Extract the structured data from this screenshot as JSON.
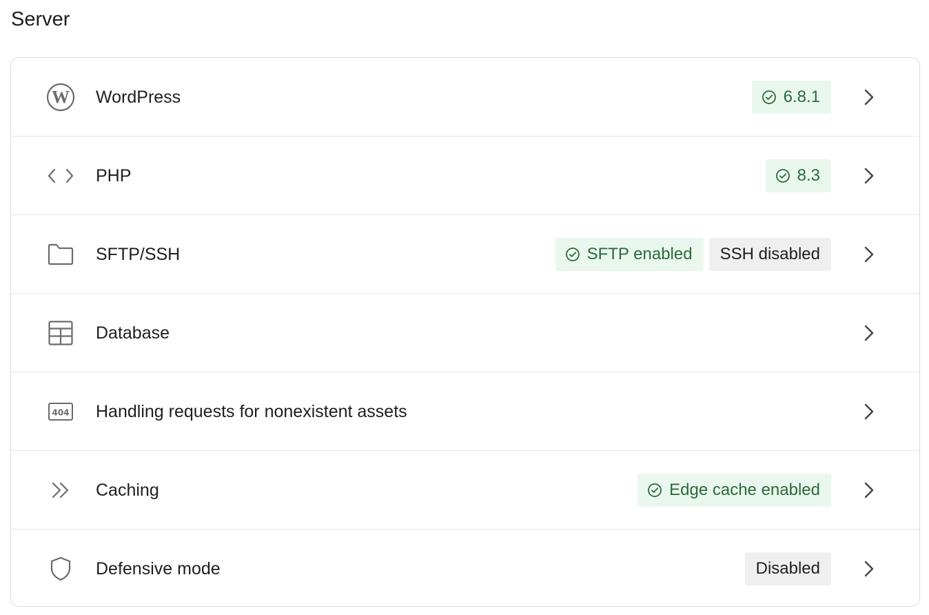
{
  "section": {
    "title": "Server"
  },
  "colors": {
    "success_bg": "#eaf7ee",
    "success_text": "#2b6a3c",
    "neutral_bg": "#efefef",
    "icon": "#6b6b6b",
    "border": "#dcdcde"
  },
  "rows": [
    {
      "label": "WordPress",
      "icon": "wordpress-icon",
      "badges": [
        {
          "text": "6.8.1",
          "status": "success"
        }
      ]
    },
    {
      "label": "PHP",
      "icon": "code-icon",
      "badges": [
        {
          "text": "8.3",
          "status": "success"
        }
      ]
    },
    {
      "label": "SFTP/SSH",
      "icon": "folder-icon",
      "badges": [
        {
          "text": "SFTP enabled",
          "status": "success"
        },
        {
          "text": "SSH disabled",
          "status": "neutral"
        }
      ]
    },
    {
      "label": "Database",
      "icon": "table-icon",
      "badges": []
    },
    {
      "label": "Handling requests for nonexistent assets",
      "icon": "404-icon",
      "icon_text": "404",
      "badges": []
    },
    {
      "label": "Caching",
      "icon": "chevrons-right-icon",
      "badges": [
        {
          "text": "Edge cache enabled",
          "status": "success"
        }
      ]
    },
    {
      "label": "Defensive mode",
      "icon": "shield-icon",
      "badges": [
        {
          "text": "Disabled",
          "status": "neutral"
        }
      ]
    }
  ]
}
